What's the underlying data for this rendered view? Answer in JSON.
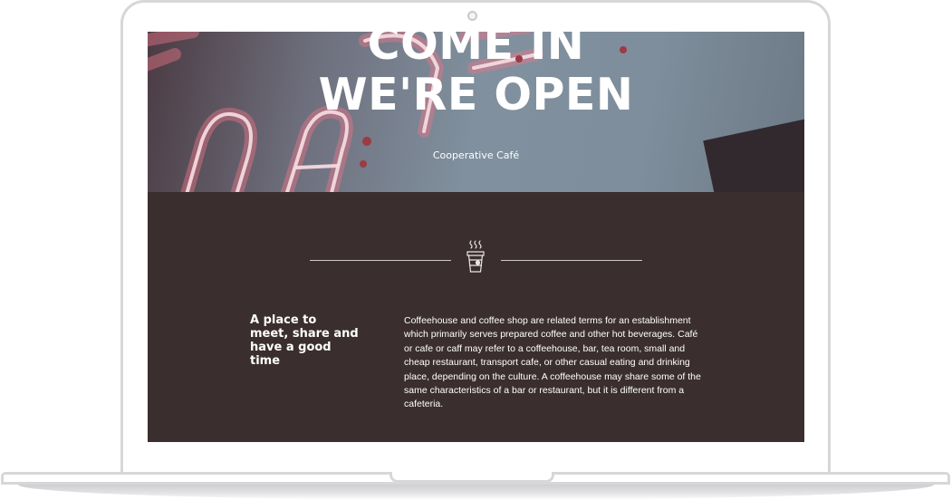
{
  "hero": {
    "title_line1": "COME IN",
    "title_line2": "WE'RE OPEN",
    "subtitle": "Cooperative Café",
    "neon_sign_text": "CAFE"
  },
  "about": {
    "divider_icon": "coffee-cup-icon",
    "tagline": "A place to meet, share and have a good time",
    "description": "Coffeehouse and coffee shop are related terms for an establishment which primarily serves prepared coffee and other hot beverages. Café or cafe or caff may refer to a coffeehouse, bar, tea room, small and cheap restaurant, transport cafe, or other casual eating and drinking place, depending on the culture. A coffeehouse may share some of the same characteristics of a bar or restaurant, but it is different from a cafeteria."
  },
  "colors": {
    "section_background": "#3a2e2e",
    "text": "#ffffff",
    "neon_pink": "#e87588",
    "frame": "#d7d7d9"
  }
}
